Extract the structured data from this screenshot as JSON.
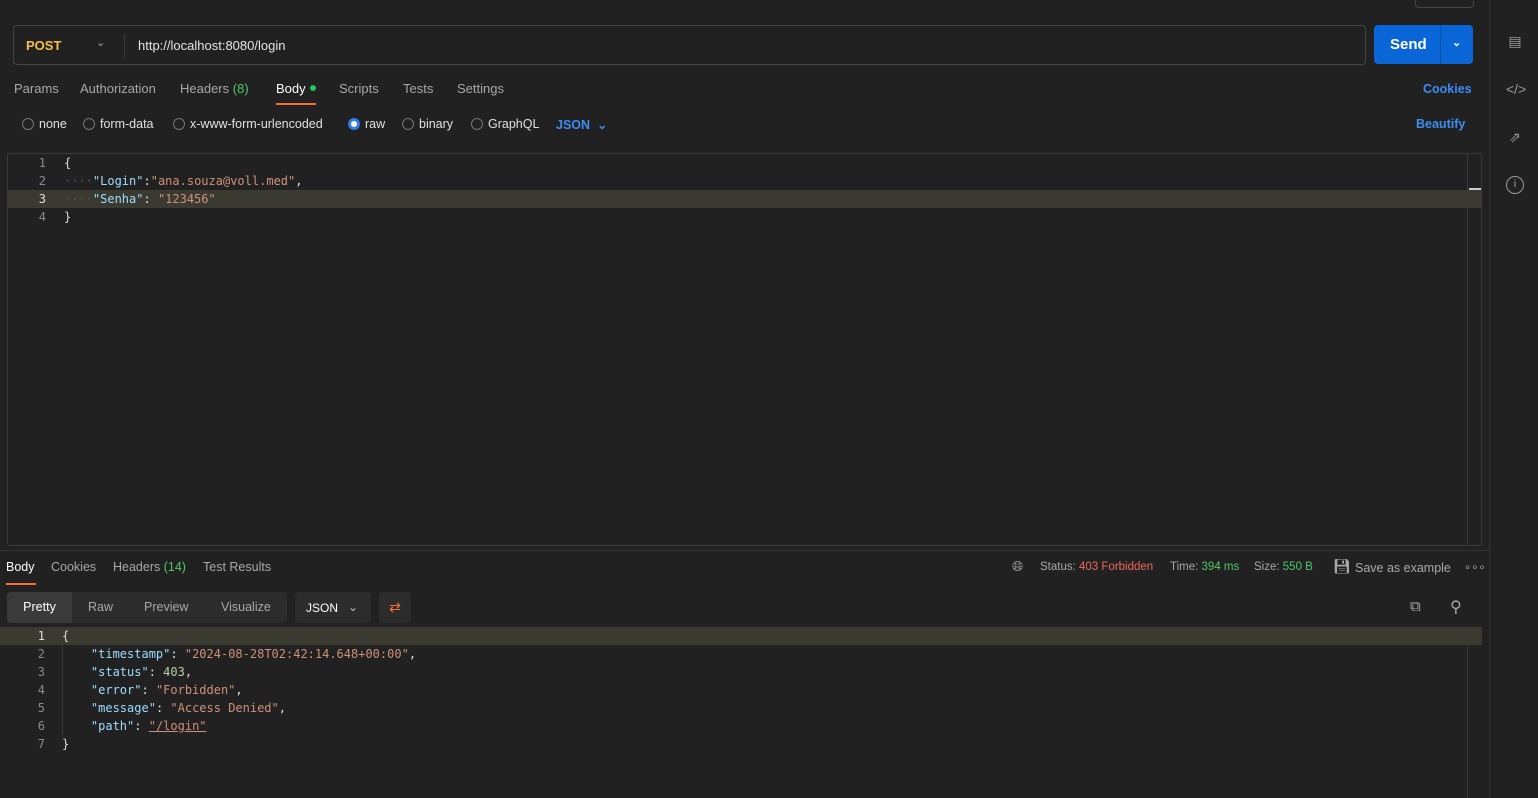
{
  "request": {
    "method": "POST",
    "url": "http://localhost:8080/login",
    "send_label": "Send",
    "tabs": [
      {
        "label": "Params"
      },
      {
        "label": "Authorization"
      },
      {
        "label": "Headers",
        "count": "(8)"
      },
      {
        "label": "Body"
      },
      {
        "label": "Scripts"
      },
      {
        "label": "Tests"
      },
      {
        "label": "Settings"
      }
    ],
    "cookies_label": "Cookies",
    "body_types": [
      "none",
      "form-data",
      "x-www-form-urlencoded",
      "raw",
      "binary",
      "GraphQL"
    ],
    "selected_body_type": "raw",
    "language": "JSON",
    "beautify_label": "Beautify",
    "body_lines": [
      {
        "n": "1",
        "text": "{"
      },
      {
        "n": "2",
        "key": "\"Login\"",
        "sep": ":",
        "val": "\"ana.souza@voll.med\"",
        "end": ","
      },
      {
        "n": "3",
        "key": "\"Senha\"",
        "sep": ": ",
        "val": "\"123456\"",
        "end": ""
      },
      {
        "n": "4",
        "text": "}"
      }
    ]
  },
  "response": {
    "tabs": [
      {
        "label": "Body"
      },
      {
        "label": "Cookies"
      },
      {
        "label": "Headers",
        "count": "(14)"
      },
      {
        "label": "Test Results"
      }
    ],
    "status_label": "Status:",
    "status": "403 Forbidden",
    "time_label": "Time:",
    "time": "394 ms",
    "size_label": "Size:",
    "size": "550 B",
    "save_label": "Save as example",
    "modes": [
      "Pretty",
      "Raw",
      "Preview",
      "Visualize"
    ],
    "format": "JSON",
    "lines": [
      {
        "n": "1",
        "text": "{"
      },
      {
        "n": "2",
        "key": "\"timestamp\"",
        "val": "\"2024-08-28T02:42:14.648+00:00\"",
        "type": "str"
      },
      {
        "n": "3",
        "key": "\"status\"",
        "val": "403",
        "type": "num"
      },
      {
        "n": "4",
        "key": "\"error\"",
        "val": "\"Forbidden\"",
        "type": "str"
      },
      {
        "n": "5",
        "key": "\"message\"",
        "val": "\"Access Denied\"",
        "type": "str"
      },
      {
        "n": "6",
        "key": "\"path\"",
        "val": "\"/login\"",
        "type": "link",
        "last": true
      },
      {
        "n": "7",
        "text": "}"
      }
    ]
  },
  "colors": {
    "accent": "#ff6c37",
    "send": "#0a66d6",
    "error": "#f0685c",
    "success": "#4ec96a"
  }
}
